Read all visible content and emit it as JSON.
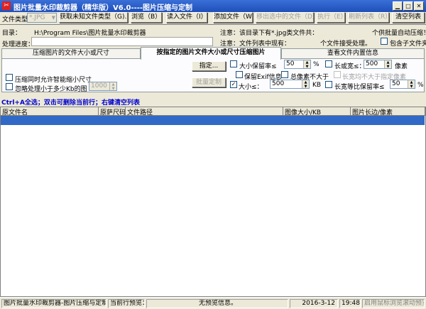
{
  "window": {
    "title": "图片批量水印裁剪器（精华版）V6.0----图片压缩与定制"
  },
  "toolbar": {
    "file_type_label": "文件类型",
    "file_type_value": "*.JPG",
    "get_unknown_types": "获取未知文件类型（G)...",
    "browse": "浏览（B）...",
    "read_file": "读入文件（I）",
    "add_file": "添加文件（W）",
    "remove_selected": "移出选中的文件（D）",
    "execute": "执行（E）",
    "refresh_list": "刷新列表（R）",
    "clear_list": "清空列表"
  },
  "info": {
    "dir_label": "目录：",
    "dir_value": "H:\\Program Files\\图片批量水印裁剪器",
    "note1": "注意：该目录下有*.jpg类文件共：",
    "note1_tail": "个供批量自动压缩！",
    "progress_label": "处理进度：",
    "note2": "注意：文件列表中现有：",
    "note2_tail": "个文件接受处理。",
    "include_subfolders": "包含子文件夹"
  },
  "tabs": [
    {
      "label": "压缩图片的文件大小或尺寸"
    },
    {
      "label": "按指定的图片文件大小或尺寸压缩图片"
    },
    {
      "label": "查看文件内置信息"
    }
  ],
  "panel": {
    "smart_shrink": "压缩同时允许智能缩小尺寸",
    "ignore_small": "忽略处理小于多少Kb的图",
    "ignore_small_value": "1000",
    "specify": "指定...",
    "custom_size": "批量定制",
    "quality_max": "大小保留率≤",
    "quality_max_value": "50",
    "percent": "%",
    "long_side": "长或宽≤：",
    "long_side_value": "500",
    "pixel_unit": "像素",
    "keep_exif": "保留Exif信息",
    "total_pixels": "总像素不大于",
    "wh_not_exceed": "长宽均不大于指定像素",
    "size_max": "大小≤：",
    "size_max_value": "500",
    "kb": "KB",
    "ratio_keep": "长宽等比保留率≤",
    "ratio_keep_value": "50",
    "percent2": "%"
  },
  "hint": "Ctrl+A全选；双击可删除当前行；右键清空列表",
  "table": {
    "columns": [
      "原文件名",
      "原萨尺码",
      "文件路径",
      "图像大小/KB",
      "图片长边/像素"
    ]
  },
  "status": {
    "app_name": "图片批量水印裁剪器-图片压缩与定制",
    "preview_label": "当前行预览：",
    "preview_value": "无预览信息。",
    "date": "2016-3-12",
    "time": "19:48",
    "hint": "启用鼠标浏览滚动预览"
  }
}
